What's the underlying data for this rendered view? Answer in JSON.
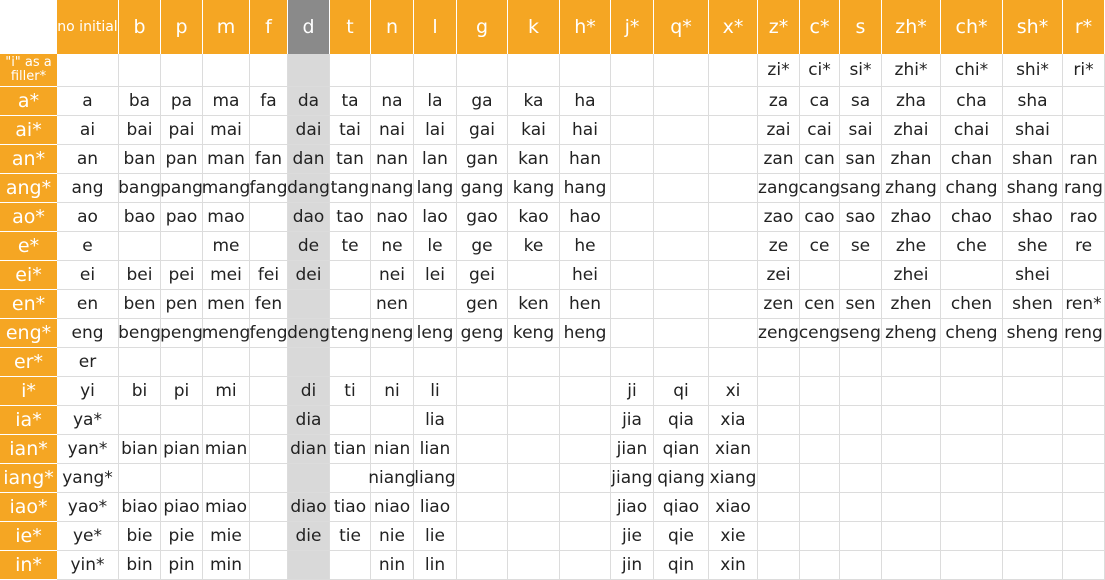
{
  "colors": {
    "header_bg": "#f5a623",
    "header_text": "#ffffff",
    "highlight_header_bg": "#8a8a8a",
    "highlight_column_bg": "#d9d9d9",
    "grid_line": "#dcdcdc",
    "cell_text": "#222222"
  },
  "highlight_column_index": 5,
  "columns": [
    "no initial",
    "b",
    "p",
    "m",
    "f",
    "d",
    "t",
    "n",
    "l",
    "g",
    "k",
    "h*",
    "j*",
    "q*",
    "x*",
    "z*",
    "c*",
    "s",
    "zh*",
    "ch*",
    "sh*",
    "r*"
  ],
  "rows": [
    {
      "label": "\"i\" as a filler*",
      "cells": [
        "",
        "",
        "",
        "",
        "",
        "",
        "",
        "",
        "",
        "",
        "",
        "",
        "",
        "",
        "",
        "zi*",
        "ci*",
        "si*",
        "zhi*",
        "chi*",
        "shi*",
        "ri*"
      ]
    },
    {
      "label": "a*",
      "cells": [
        "a",
        "ba",
        "pa",
        "ma",
        "fa",
        "da",
        "ta",
        "na",
        "la",
        "ga",
        "ka",
        "ha",
        "",
        "",
        "",
        "za",
        "ca",
        "sa",
        "zha",
        "cha",
        "sha",
        ""
      ]
    },
    {
      "label": "ai*",
      "cells": [
        "ai",
        "bai",
        "pai",
        "mai",
        "",
        "dai",
        "tai",
        "nai",
        "lai",
        "gai",
        "kai",
        "hai",
        "",
        "",
        "",
        "zai",
        "cai",
        "sai",
        "zhai",
        "chai",
        "shai",
        ""
      ]
    },
    {
      "label": "an*",
      "cells": [
        "an",
        "ban",
        "pan",
        "man",
        "fan",
        "dan",
        "tan",
        "nan",
        "lan",
        "gan",
        "kan",
        "han",
        "",
        "",
        "",
        "zan",
        "can",
        "san",
        "zhan",
        "chan",
        "shan",
        "ran"
      ]
    },
    {
      "label": "ang*",
      "cells": [
        "ang",
        "bang",
        "pang",
        "mang",
        "fang",
        "dang",
        "tang",
        "nang",
        "lang",
        "gang",
        "kang",
        "hang",
        "",
        "",
        "",
        "zang",
        "cang",
        "sang",
        "zhang",
        "chang",
        "shang",
        "rang"
      ]
    },
    {
      "label": "ao*",
      "cells": [
        "ao",
        "bao",
        "pao",
        "mao",
        "",
        "dao",
        "tao",
        "nao",
        "lao",
        "gao",
        "kao",
        "hao",
        "",
        "",
        "",
        "zao",
        "cao",
        "sao",
        "zhao",
        "chao",
        "shao",
        "rao"
      ]
    },
    {
      "label": "e*",
      "cells": [
        "e",
        "",
        "",
        "me",
        "",
        "de",
        "te",
        "ne",
        "le",
        "ge",
        "ke",
        "he",
        "",
        "",
        "",
        "ze",
        "ce",
        "se",
        "zhe",
        "che",
        "she",
        "re"
      ]
    },
    {
      "label": "ei*",
      "cells": [
        "ei",
        "bei",
        "pei",
        "mei",
        "fei",
        "dei",
        "",
        "nei",
        "lei",
        "gei",
        "",
        "hei",
        "",
        "",
        "",
        "zei",
        "",
        "",
        "zhei",
        "",
        "shei",
        ""
      ]
    },
    {
      "label": "en*",
      "cells": [
        "en",
        "ben",
        "pen",
        "men",
        "fen",
        "",
        "",
        "nen",
        "",
        "gen",
        "ken",
        "hen",
        "",
        "",
        "",
        "zen",
        "cen",
        "sen",
        "zhen",
        "chen",
        "shen",
        "ren*"
      ]
    },
    {
      "label": "eng*",
      "cells": [
        "eng",
        "beng",
        "peng",
        "meng",
        "feng",
        "deng",
        "teng",
        "neng",
        "leng",
        "geng",
        "keng",
        "heng",
        "",
        "",
        "",
        "zeng",
        "ceng",
        "seng",
        "zheng",
        "cheng",
        "sheng",
        "reng"
      ]
    },
    {
      "label": "er*",
      "cells": [
        "er",
        "",
        "",
        "",
        "",
        "",
        "",
        "",
        "",
        "",
        "",
        "",
        "",
        "",
        "",
        "",
        "",
        "",
        "",
        "",
        "",
        ""
      ]
    },
    {
      "label": "i*",
      "cells": [
        "yi",
        "bi",
        "pi",
        "mi",
        "",
        "di",
        "ti",
        "ni",
        "li",
        "",
        "",
        "",
        "ji",
        "qi",
        "xi",
        "",
        "",
        "",
        "",
        "",
        "",
        ""
      ]
    },
    {
      "label": "ia*",
      "cells": [
        "ya*",
        "",
        "",
        "",
        "",
        "dia",
        "",
        "",
        "lia",
        "",
        "",
        "",
        "jia",
        "qia",
        "xia",
        "",
        "",
        "",
        "",
        "",
        "",
        ""
      ]
    },
    {
      "label": "ian*",
      "cells": [
        "yan*",
        "bian",
        "pian",
        "mian",
        "",
        "dian",
        "tian",
        "nian",
        "lian",
        "",
        "",
        "",
        "jian",
        "qian",
        "xian",
        "",
        "",
        "",
        "",
        "",
        "",
        ""
      ]
    },
    {
      "label": "iang*",
      "cells": [
        "yang*",
        "",
        "",
        "",
        "",
        "",
        "",
        "niang",
        "liang",
        "",
        "",
        "",
        "jiang",
        "qiang",
        "xiang",
        "",
        "",
        "",
        "",
        "",
        "",
        ""
      ]
    },
    {
      "label": "iao*",
      "cells": [
        "yao*",
        "biao",
        "piao",
        "miao",
        "",
        "diao",
        "tiao",
        "niao",
        "liao",
        "",
        "",
        "",
        "jiao",
        "qiao",
        "xiao",
        "",
        "",
        "",
        "",
        "",
        "",
        ""
      ]
    },
    {
      "label": "ie*",
      "cells": [
        "ye*",
        "bie",
        "pie",
        "mie",
        "",
        "die",
        "tie",
        "nie",
        "lie",
        "",
        "",
        "",
        "jie",
        "qie",
        "xie",
        "",
        "",
        "",
        "",
        "",
        "",
        ""
      ]
    },
    {
      "label": "in*",
      "cells": [
        "yin*",
        "bin",
        "pin",
        "min",
        "",
        "",
        "",
        "nin",
        "lin",
        "",
        "",
        "",
        "jin",
        "qin",
        "xin",
        "",
        "",
        "",
        "",
        "",
        "",
        ""
      ]
    }
  ]
}
